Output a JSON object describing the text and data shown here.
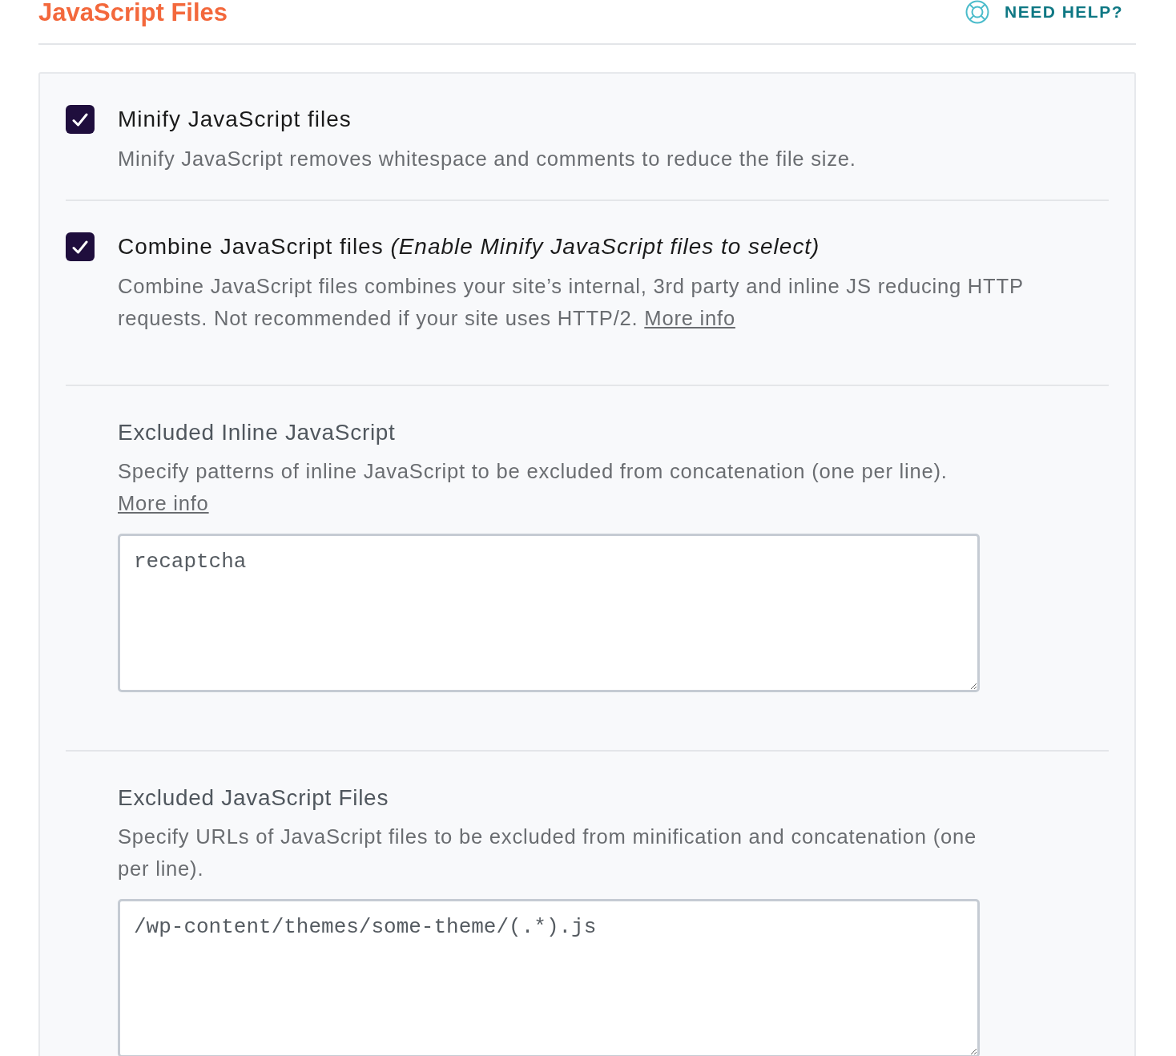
{
  "header": {
    "title": "JavaScript Files",
    "help_link": "NEED HELP?"
  },
  "options": [
    {
      "label": "Minify JavaScript files",
      "checked": true,
      "description": "Minify JavaScript removes whitespace and comments to reduce the file size."
    },
    {
      "label": "Combine JavaScript files *(Enable Minify JavaScript files to select)*",
      "checked": true,
      "description": "Combine JavaScript files combines your site’s internal, 3rd party and inline JS reducing HTTP requests. Not recommended if your site uses HTTP/2.",
      "link": "More info"
    }
  ],
  "fields": [
    {
      "title": "Excluded Inline JavaScript",
      "description": "Specify patterns of inline JavaScript to be excluded from concatenation (one per line).",
      "link": "More info",
      "value": "recaptcha"
    },
    {
      "title": "Excluded JavaScript Files",
      "description": "Specify URLs of JavaScript files to be excluded from minification and concatenation (one per line).",
      "value": "/wp-content/themes/some-theme/(.*).js"
    }
  ]
}
